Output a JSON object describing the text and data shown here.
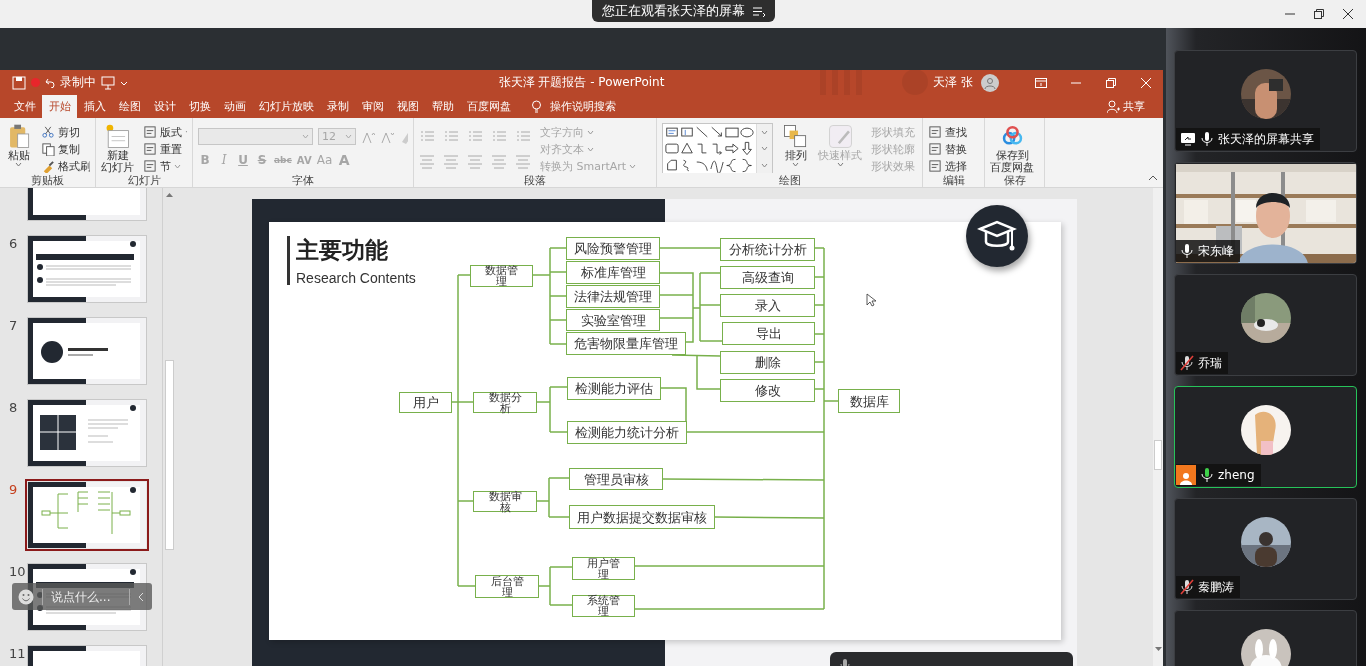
{
  "viewer_banner": "您正在观看张天泽的屏幕",
  "powerpoint": {
    "recording_label": "录制中",
    "document_title": "张天泽 开题报告 - PowerPoint",
    "user_name": "天泽 张",
    "tabs": [
      {
        "label": "文件",
        "selected": false
      },
      {
        "label": "开始",
        "selected": true
      },
      {
        "label": "插入",
        "selected": false
      },
      {
        "label": "绘图",
        "selected": false
      },
      {
        "label": "设计",
        "selected": false
      },
      {
        "label": "切换",
        "selected": false
      },
      {
        "label": "动画",
        "selected": false
      },
      {
        "label": "幻灯片放映",
        "selected": false
      },
      {
        "label": "录制",
        "selected": false
      },
      {
        "label": "审阅",
        "selected": false
      },
      {
        "label": "视图",
        "selected": false
      },
      {
        "label": "帮助",
        "selected": false
      },
      {
        "label": "百度网盘",
        "selected": false
      }
    ],
    "tell_me": "操作说明搜索",
    "share_button": "共享",
    "ribbon_groups": [
      {
        "name": "剪贴板",
        "commands": [
          {
            "kind": "large",
            "lines": [
              "粘贴"
            ],
            "disabled": false
          },
          {
            "kind": "small",
            "label": "剪切",
            "disabled": false
          },
          {
            "kind": "small",
            "label": "复制",
            "disabled": false
          },
          {
            "kind": "small",
            "label": "格式刷",
            "disabled": false
          }
        ]
      },
      {
        "name": "幻灯片",
        "commands": [
          {
            "kind": "large",
            "lines": [
              "新建",
              "幻灯片"
            ],
            "disabled": false
          },
          {
            "kind": "small",
            "label": "版式",
            "disabled": false
          },
          {
            "kind": "small",
            "label": "重置",
            "disabled": false
          },
          {
            "kind": "small",
            "label": "节",
            "disabled": false
          }
        ]
      },
      {
        "name": "字体",
        "commands": [
          {
            "kind": "field",
            "disabled": true
          },
          {
            "kind": "field",
            "label": "12",
            "disabled": true
          },
          {
            "kind": "glyph",
            "label": "B",
            "disabled": true
          },
          {
            "kind": "glyph",
            "label": "I",
            "disabled": true
          },
          {
            "kind": "glyph",
            "label": "U",
            "disabled": true
          },
          {
            "kind": "glyph",
            "label": "S",
            "disabled": true
          },
          {
            "kind": "glyph",
            "label": "abc",
            "disabled": true
          },
          {
            "kind": "glyph",
            "label": "AV",
            "disabled": true
          },
          {
            "kind": "glyph",
            "label": "Aa",
            "disabled": true
          },
          {
            "kind": "glyph",
            "label": "A",
            "disabled": true
          }
        ]
      },
      {
        "name": "段落",
        "commands": [
          {
            "kind": "small",
            "label": "文字方向",
            "disabled": true
          },
          {
            "kind": "small",
            "label": "对齐文本",
            "disabled": true
          },
          {
            "kind": "small",
            "label": "转换为 SmartArt",
            "disabled": true
          }
        ]
      },
      {
        "name": "绘图",
        "commands": [
          {
            "kind": "large",
            "lines": [
              "排列"
            ],
            "disabled": false
          },
          {
            "kind": "large",
            "lines": [
              "快速样式"
            ],
            "disabled": true
          },
          {
            "kind": "small",
            "label": "形状填充",
            "disabled": true
          },
          {
            "kind": "small",
            "label": "形状轮廓",
            "disabled": true
          },
          {
            "kind": "small",
            "label": "形状效果",
            "disabled": true
          }
        ]
      },
      {
        "name": "编辑",
        "commands": [
          {
            "kind": "small",
            "label": "查找",
            "disabled": false
          },
          {
            "kind": "small",
            "label": "替换",
            "disabled": false
          },
          {
            "kind": "small",
            "label": "选择",
            "disabled": false
          }
        ]
      },
      {
        "name": "保存",
        "commands": [
          {
            "kind": "large",
            "lines": [
              "保存到",
              "百度网盘"
            ],
            "disabled": false
          }
        ]
      }
    ],
    "slides": [
      {
        "selected": false
      },
      {
        "number": "6",
        "selected": false
      },
      {
        "number": "7",
        "selected": false
      },
      {
        "number": "8",
        "selected": false
      },
      {
        "number": "9",
        "selected": true
      },
      {
        "number": "10",
        "selected": false
      },
      {
        "number": "11",
        "selected": false
      }
    ],
    "slide": {
      "title": "主要功能",
      "subtitle": "Research Contents",
      "diagram_nodes": [
        "用户",
        "数据管理",
        "数据分析",
        "数据审核",
        "后台管理",
        "风险预警管理",
        "标准库管理",
        "法律法规管理",
        "实验室管理",
        "危害物限量库管理",
        "检测能力评估",
        "检测能力统计分析",
        "管理员审核",
        "用户数据提交数据审核",
        "用户管理",
        "系统管理",
        "分析统计分析",
        "高级查询",
        "录入",
        "导出",
        "删除",
        "修改",
        "数据库"
      ]
    },
    "chat_input": {
      "placeholder": "说点什么..."
    }
  },
  "participants": [
    {
      "name": "张天泽的屏幕共享",
      "kind": "avatar",
      "sharing": true,
      "muted": false,
      "speaking": false,
      "self": false
    },
    {
      "name": "宋东峰",
      "kind": "video",
      "sharing": false,
      "muted": false,
      "speaking": false,
      "self": false
    },
    {
      "name": "乔瑞",
      "kind": "avatar",
      "sharing": false,
      "muted": true,
      "speaking": false,
      "self": false
    },
    {
      "name": "zheng",
      "kind": "avatar",
      "sharing": false,
      "muted": false,
      "speaking": true,
      "self": true
    },
    {
      "name": "秦鹏涛",
      "kind": "avatar",
      "sharing": false,
      "muted": true,
      "speaking": false,
      "self": false
    },
    {
      "kind": "avatar"
    }
  ]
}
